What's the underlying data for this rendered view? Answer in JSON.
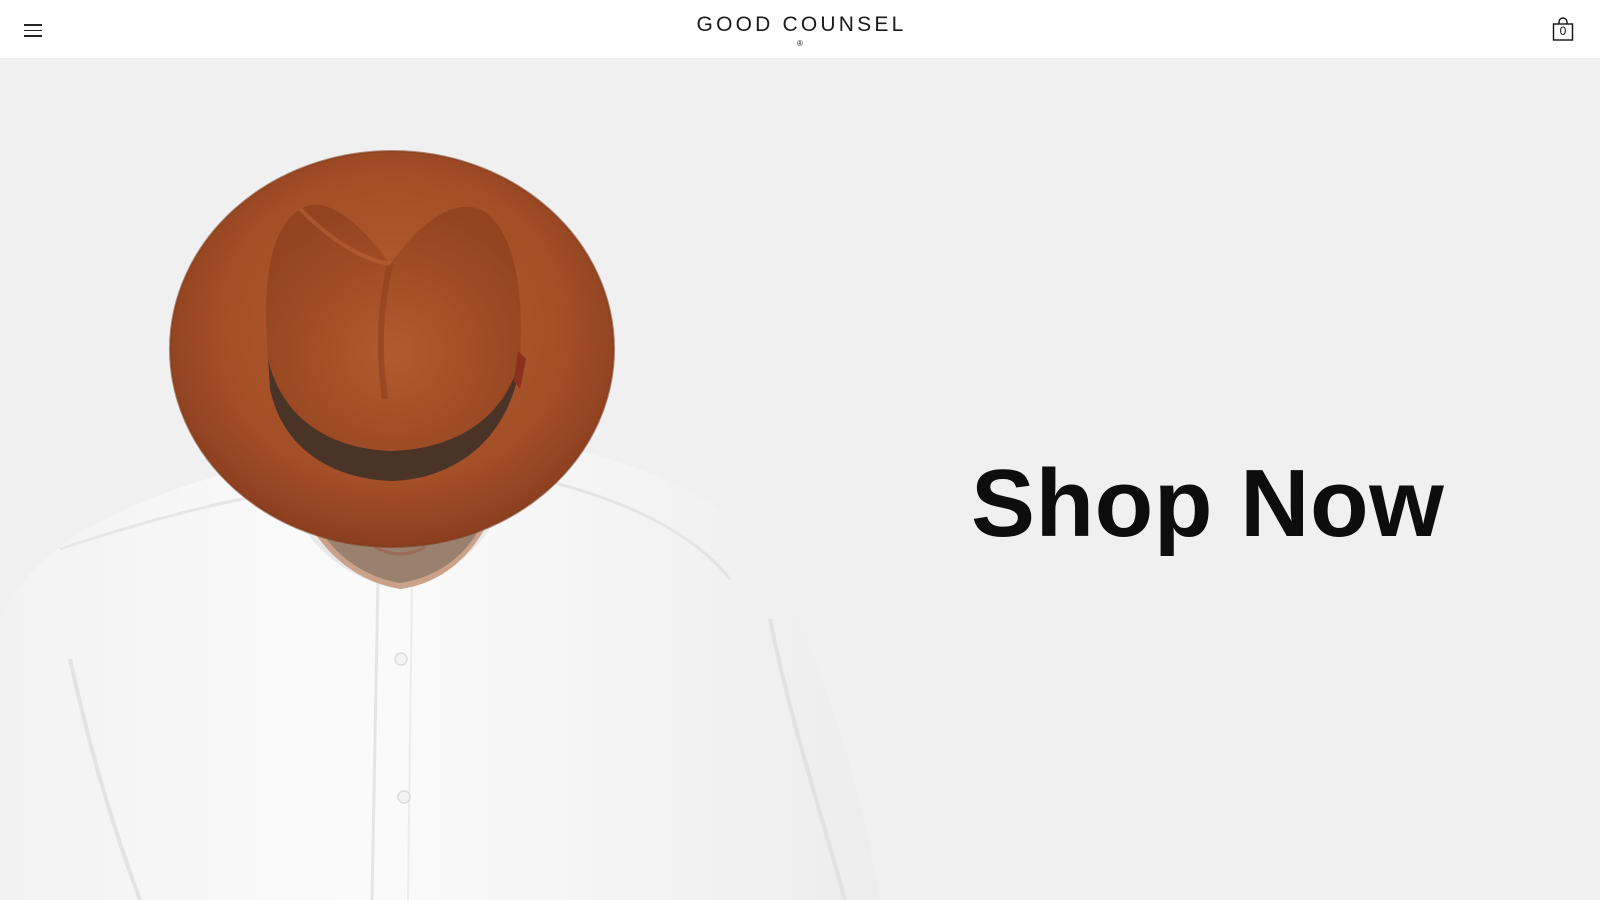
{
  "header": {
    "brand": "GOOD COUNSEL",
    "brand_mark": "®",
    "cart_count": "0",
    "icons": {
      "menu": "hamburger-menu-icon",
      "cart": "shopping-bag-icon"
    }
  },
  "hero": {
    "cta_label": "Shop Now",
    "image_subject": "man-in-rust-fedora-and-white-shirt",
    "colors": {
      "background": "#f0f0f0",
      "hat": "#a9522a",
      "hat_band": "#4a3428",
      "shirt": "#fafafa"
    }
  }
}
